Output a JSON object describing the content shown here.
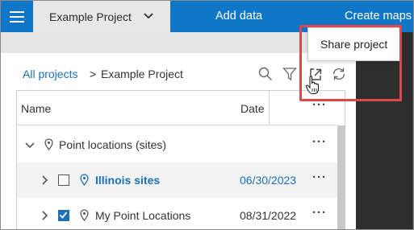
{
  "topbar": {
    "project_name": "Example Project",
    "add_data_label": "Add data",
    "create_maps_label": "Create maps",
    "accent_color": "#0f76c8"
  },
  "breadcrumb": {
    "link": "All projects",
    "separator": ">",
    "current": "Example Project"
  },
  "toolbar": {
    "icons": [
      "search-icon",
      "filter-icon",
      "share-icon",
      "refresh-icon"
    ]
  },
  "tooltip": {
    "text": "Share project"
  },
  "table": {
    "columns": {
      "name": "Name",
      "date": "Date",
      "more": "···"
    },
    "rows": [
      {
        "name": "Point locations (sites)",
        "date": "",
        "more": "···",
        "checked": null,
        "highlighted": false
      },
      {
        "name": "Illinois sites",
        "date": "06/30/2023",
        "more": "···",
        "checked": false,
        "highlighted": true
      },
      {
        "name": "My Point Locations",
        "date": "08/31/2022",
        "more": "···",
        "checked": true,
        "highlighted": false
      }
    ]
  },
  "colors": {
    "link": "#1d6fb8",
    "highlight_box": "#e0474c"
  }
}
